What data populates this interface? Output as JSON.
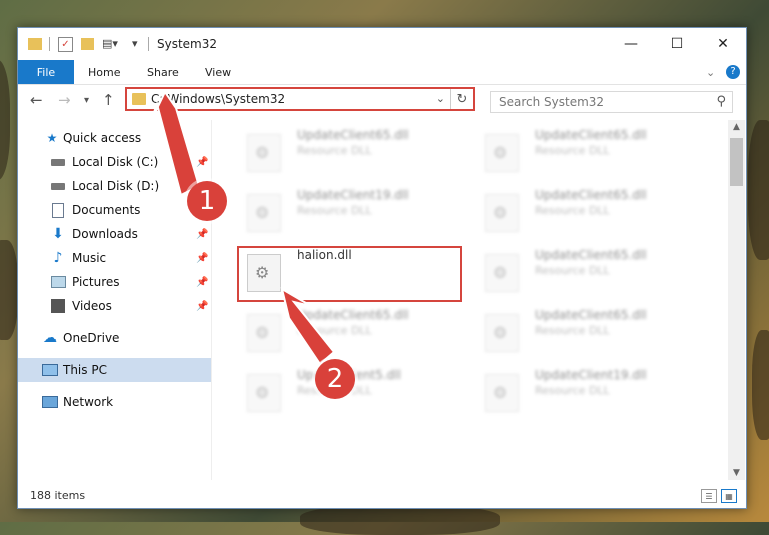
{
  "window": {
    "title": "System32",
    "controls": {
      "minimize": "—",
      "maximize": "☐",
      "close": "✕"
    }
  },
  "ribbon": {
    "tabs": [
      {
        "label": "File"
      },
      {
        "label": "Home"
      },
      {
        "label": "Share"
      },
      {
        "label": "View"
      }
    ]
  },
  "nav": {
    "address": "C:\\Windows\\System32",
    "search_placeholder": "Search System32"
  },
  "sidebar": {
    "items": [
      {
        "label": "Quick access",
        "icon": "star-icon"
      },
      {
        "label": "Local Disk (C:)",
        "icon": "drive-icon"
      },
      {
        "label": "Local Disk (D:)",
        "icon": "drive-icon"
      },
      {
        "label": "Documents",
        "icon": "documents-icon"
      },
      {
        "label": "Downloads",
        "icon": "download-icon"
      },
      {
        "label": "Music",
        "icon": "music-icon"
      },
      {
        "label": "Pictures",
        "icon": "pictures-icon"
      },
      {
        "label": "Videos",
        "icon": "videos-icon"
      },
      {
        "label": "OneDrive",
        "icon": "cloud-icon"
      },
      {
        "label": "This PC",
        "icon": "computer-icon"
      },
      {
        "label": "Network",
        "icon": "network-icon"
      }
    ]
  },
  "files": [
    {
      "name": "UpdateClient65.dll",
      "type": "Resource DLL"
    },
    {
      "name": "UpdateClient65.dll",
      "type": "Resource DLL"
    },
    {
      "name": "UpdateClient19.dll",
      "type": "Resource DLL"
    },
    {
      "name": "UpdateClient65.dll",
      "type": "Resource DLL"
    },
    {
      "name": "halion.dll",
      "type": ""
    },
    {
      "name": "UpdateClient65.dll",
      "type": "Resource DLL"
    },
    {
      "name": "UpdateClient65.dll",
      "type": "Resource DLL"
    },
    {
      "name": "UpdateClient65.dll",
      "type": "Resource DLL"
    },
    {
      "name": "UpdateClient5.dll",
      "type": "Resource DLL"
    },
    {
      "name": "UpdateClient19.dll",
      "type": "Resource DLL"
    }
  ],
  "status": {
    "item_count": "188 items"
  },
  "callouts": {
    "one": "1",
    "two": "2"
  },
  "colors": {
    "accent": "#1979ca",
    "highlight": "#d5453d",
    "selected": "#ccdcef"
  }
}
